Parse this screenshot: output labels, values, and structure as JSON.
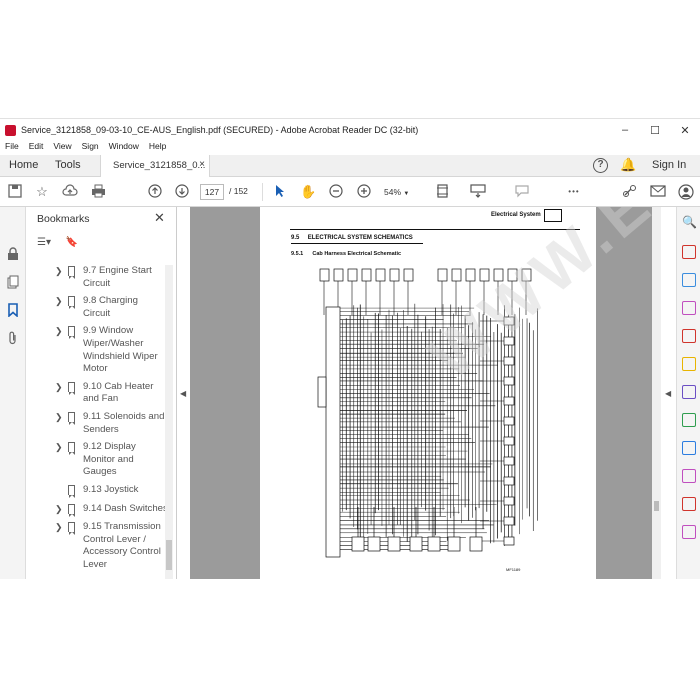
{
  "window": {
    "title": "Service_3121858_09-03-10_CE-AUS_English.pdf (SECURED) - Adobe Acrobat Reader DC (32-bit)",
    "minimize_glyph": "–",
    "maximize_glyph": "☐",
    "close_glyph": "✕"
  },
  "menu": [
    "File",
    "Edit",
    "View",
    "Sign",
    "Window",
    "Help"
  ],
  "tabs": {
    "home": "Home",
    "tools": "Tools",
    "document": "Service_3121858_0...",
    "close_glyph": "×"
  },
  "account": {
    "help_glyph": "?",
    "sign_in": "Sign In"
  },
  "toolbar": {
    "page_current": "127",
    "page_total": "/  152",
    "zoom": "54%",
    "more_glyph": "•••"
  },
  "bookmarks": {
    "title": "Bookmarks",
    "close_glyph": "✕",
    "items": [
      {
        "label": "9.7 Engine Start\nCircuit",
        "expandable": true
      },
      {
        "label": "9.8 Charging\nCircuit",
        "expandable": true
      },
      {
        "label": "9.9 Window\nWiper/Washer\nWindshield Wiper\nMotor",
        "expandable": true
      },
      {
        "label": "9.10 Cab Heater\nand Fan",
        "expandable": true
      },
      {
        "label": "9.11 Solenoids and\nSenders",
        "expandable": true
      },
      {
        "label": "9.12 Display\nMonitor and\nGauges",
        "expandable": true
      },
      {
        "label": "9.13 Joystick",
        "expandable": false
      },
      {
        "label": "9.14 Dash Switches",
        "expandable": true
      },
      {
        "label": "9.15 Transmission\nControl Lever /\nAccessory Control\nLever",
        "expandable": true
      }
    ]
  },
  "document": {
    "header": "Electrical System",
    "section_number": "9.5",
    "section_title": "ELECTRICAL SYSTEM SCHEMATICS",
    "subsection_number": "9.5.1",
    "subsection_title": "Cab Harness Electrical Schematic",
    "figure_code": "MF1189",
    "watermark": "WWW.EPCATALOGS.COM"
  },
  "colors": {
    "accent_red": "#c8102e",
    "right_tools": [
      "#d0342c",
      "#3a8dde",
      "#c04fbf",
      "#d0342c",
      "#e8b400",
      "#6b4fc4",
      "#2e9d4e",
      "#2c7de0",
      "#c04fbf",
      "#d0342c",
      "#c04fbf"
    ]
  }
}
